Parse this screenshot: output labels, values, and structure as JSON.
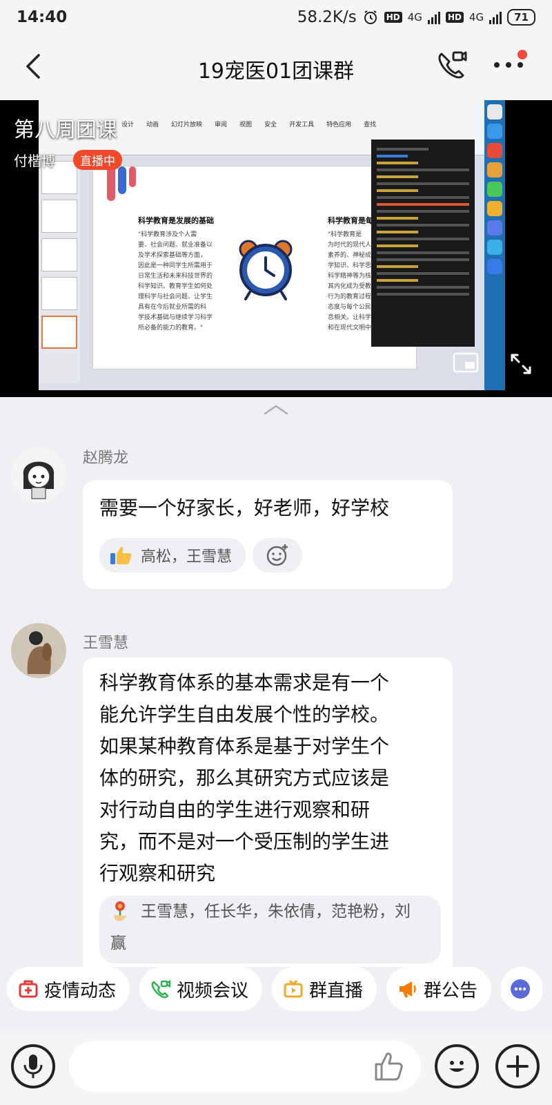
{
  "status_bar": {
    "time": "14:40",
    "network_speed": "58.2K/s",
    "hd1": "HD",
    "net1": "4G",
    "hd2": "HD",
    "net2": "4G",
    "battery": "71"
  },
  "header": {
    "title": "19宠医01团课群",
    "back_icon": "chevron-left-icon",
    "call_icon": "phone-video-icon",
    "more_icon": "more-dots-icon"
  },
  "live": {
    "title": "第八周团课",
    "host": "付楷博",
    "badge": "直播中",
    "slide_heading_left": "科学教育是发展的基础",
    "slide_heading_right": "科学教育是每个",
    "slide_text_left": [
      "\"科学教育涉及个人需",
      "要、社会问题、就业准备以",
      "及学术探索基础等方面，",
      "因此是一种同学生所需用于",
      "日常生活和未来科技世界的",
      "科学知识、教育学生如何处",
      "理科学与社会问题、让学生",
      "具有在今后就业所需的科",
      "学技术基础与继续学习科学",
      "所必备的能力的教育。\""
    ],
    "slide_text_right": [
      "\"科学教育是",
      "为时代的现代人所",
      "素养的、神秘成熟",
      "学知识、科学思想",
      "科学精神等为核",
      "其内化成为受教育",
      "行为的教育过程。",
      "态度与每个公民都",
      "息相关。让科学教",
      "和在现代文明中实"
    ],
    "ribbon_tabs": [
      "设计",
      "动画",
      "幻灯片放映",
      "审阅",
      "视图",
      "安全",
      "开发工具",
      "特色应用",
      "查找"
    ]
  },
  "messages": [
    {
      "sender": "赵腾龙",
      "text": "需要一个好家长，好老师，好学校",
      "reaction_icon": "thumbs-up-icon",
      "reactors": "高松，王雪慧"
    },
    {
      "sender": "王雪慧",
      "text_lines": [
        "科学教育体系的基本需求是有一个",
        "能允许学生自由发展个性的学校。",
        "如果某种教育体系是基于对学生个",
        "体的研究，那么其研究方式应该是",
        "对行动自由的学生进行观察和研",
        "究，而不是对一个受压制的学生进",
        "行观察和研究"
      ],
      "reaction_icon": "flower-icon",
      "reactors_line1": "王雪慧，任长华，朱依倩，范艳粉，刘",
      "reactors_line2": "赢"
    }
  ],
  "quick_actions": [
    {
      "label": "疫情动态",
      "icon": "medical-kit-icon",
      "color": "#e53935"
    },
    {
      "label": "视频会议",
      "icon": "video-call-icon",
      "color": "#2bb24c"
    },
    {
      "label": "群直播",
      "icon": "live-tv-icon",
      "color": "#f5a623"
    },
    {
      "label": "群公告",
      "icon": "megaphone-icon",
      "color": "#f57c00"
    }
  ],
  "input_bar": {
    "voice_icon": "microphone-icon",
    "like_icon": "thumbs-up-outline-icon",
    "emoji_icon": "emoji-icon",
    "plus_icon": "plus-icon"
  }
}
